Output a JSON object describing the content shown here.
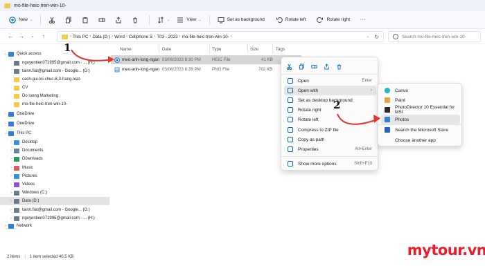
{
  "window": {
    "title": "mo-file-heic-tren-win-10-"
  },
  "toolbar": {
    "new_label": "New",
    "view_label": "View",
    "set_background_label": "Set as background",
    "rotate_left_label": "Rotate left",
    "rotate_right_label": "Rotate right"
  },
  "address": {
    "crumbs": [
      "This PC",
      "Data (D:)",
      "Word",
      "Cellphone S",
      "T03 - 2023",
      "mo-file-heic-tren-win-10-"
    ],
    "search_placeholder": "Search mo-file-heic-tren-win-10-"
  },
  "sidebar": {
    "items": [
      {
        "label": "Quick access",
        "icon": "star-icon",
        "chevron": "⌄"
      },
      {
        "label": "nguyentien071995@gmail.com - ... (H:)",
        "icon": "drive-icon"
      },
      {
        "label": "tainn.fiat@gmail.com - Google... (G:)",
        "icon": "drive-icon"
      },
      {
        "label": "cach-gui-loi-chuc-8-3-hang-loat-",
        "icon": "folder-icon"
      },
      {
        "label": "CV",
        "icon": "folder-icon"
      },
      {
        "label": "Do luong Marketing",
        "icon": "folder-icon"
      },
      {
        "label": "mo-file-heic-tren-win-10-",
        "icon": "folder-icon"
      },
      {
        "label": "OneDrive",
        "icon": "cloud-icon",
        "chevron": "›"
      },
      {
        "label": "OneDrive",
        "icon": "cloud-icon",
        "chevron": "›"
      },
      {
        "label": "This PC",
        "icon": "pc-icon",
        "chevron": "⌄"
      },
      {
        "label": "Desktop",
        "icon": "desktop-icon",
        "chevron": "›"
      },
      {
        "label": "Documents",
        "icon": "documents-icon",
        "chevron": "›"
      },
      {
        "label": "Downloads",
        "icon": "downloads-icon",
        "chevron": "›"
      },
      {
        "label": "Music",
        "icon": "music-icon",
        "chevron": "›"
      },
      {
        "label": "Pictures",
        "icon": "pictures-icon",
        "chevron": "›"
      },
      {
        "label": "Videos",
        "icon": "videos-icon",
        "chevron": "›"
      },
      {
        "label": "Windows (C:)",
        "icon": "drive-icon",
        "chevron": "›"
      },
      {
        "label": "Data (D:)",
        "icon": "drive-icon",
        "chevron": "›",
        "selected": true
      },
      {
        "label": "tainn.fiat@gmail.com - Google... (G:)",
        "icon": "drive-icon",
        "chevron": "›"
      },
      {
        "label": "nguyentien071995@gmail.com - ... (H:)",
        "icon": "drive-icon",
        "chevron": "›"
      },
      {
        "label": "Network",
        "icon": "network-icon",
        "chevron": "›"
      }
    ]
  },
  "file_list": {
    "columns": [
      "Name",
      "Date",
      "Type",
      "Size",
      "Tags"
    ],
    "rows": [
      {
        "name": "meo-anh-long-ngan",
        "date": "03/06/2023 8:30 PM",
        "type": "HEIC File",
        "size": "41 KB",
        "selected": true
      },
      {
        "name": "meo-anh-long-ngan",
        "date": "03/06/2023 8:28 PM",
        "type": "PNG File",
        "size": "702 KB"
      }
    ]
  },
  "context_menu": {
    "items": [
      {
        "label": "Open",
        "shortcut": "Enter",
        "icon": "open-icon"
      },
      {
        "label": "Open with",
        "shortcut": "›",
        "icon": "open-with-icon",
        "highlighted": true
      },
      {
        "label": "Set as desktop background",
        "shortcut": "",
        "icon": "background-icon"
      },
      {
        "label": "Rotate right",
        "shortcut": "",
        "icon": "rotate-right-icon"
      },
      {
        "label": "Rotate left",
        "shortcut": "",
        "icon": "rotate-left-icon"
      },
      {
        "label": "Compress to ZIP file",
        "shortcut": "",
        "icon": "zip-icon"
      },
      {
        "label": "Copy as path",
        "shortcut": "",
        "icon": "copy-path-icon"
      },
      {
        "label": "Properties",
        "shortcut": "Alt+Enter",
        "icon": "properties-icon"
      },
      {
        "label": "Show more options",
        "shortcut": "Shift+F10",
        "icon": "more-options-icon"
      }
    ]
  },
  "open_with_menu": {
    "items": [
      {
        "label": "Canva",
        "icon": "canva-icon"
      },
      {
        "label": "Paint",
        "icon": "paint-icon"
      },
      {
        "label": "PhotoDirector 10 Essential for MSI",
        "icon": "photodirector-icon"
      },
      {
        "label": "Photos",
        "icon": "photos-icon",
        "highlighted": true
      },
      {
        "label": "Search the Microsoft Store",
        "icon": "store-icon"
      },
      {
        "label": "Choose another app",
        "icon": ""
      }
    ]
  },
  "status_bar": {
    "count": "2 items",
    "selected": "1 item selected  40.5 KB"
  },
  "annotations": {
    "step1": "1",
    "step2": "2"
  },
  "watermark": "mytour.vn",
  "colors": {
    "accent": "#0067c0",
    "arrow": "#e8332f",
    "watermark": "#ef1b2a",
    "folder": "#f3c94e"
  }
}
